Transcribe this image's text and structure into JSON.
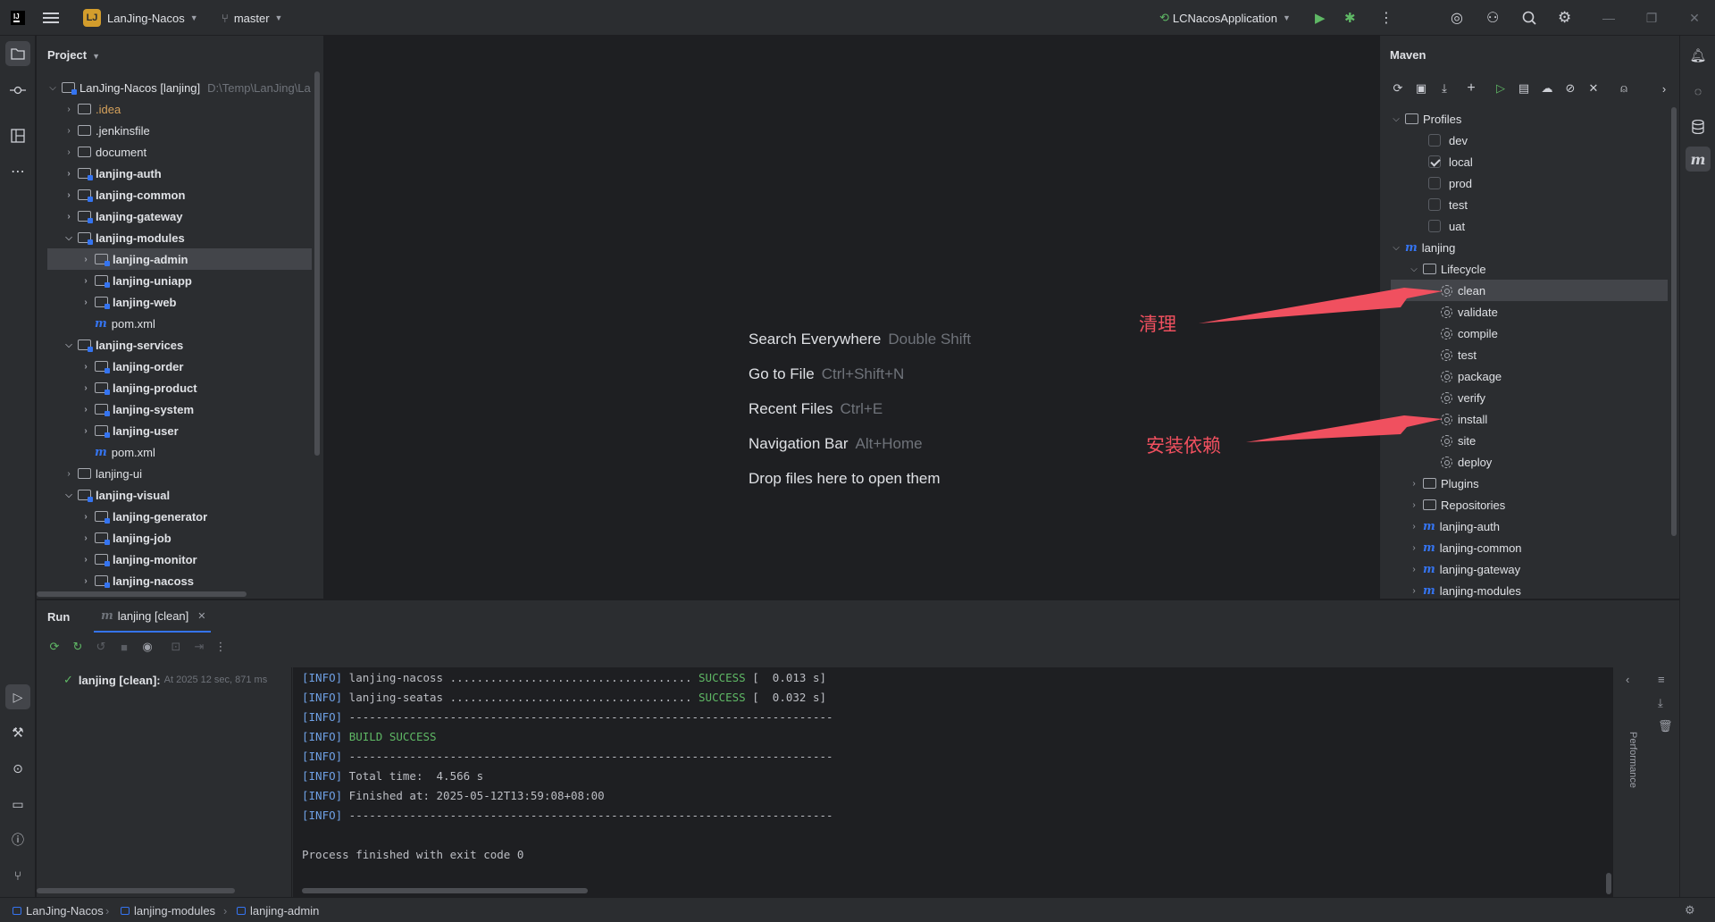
{
  "titlebar": {
    "project_badge": "LJ",
    "project_name": "LanJing-Nacos",
    "branch": "master",
    "run_config": "LCNacosApplication"
  },
  "project_panel": {
    "title": "Project",
    "root": {
      "label": "LanJing-Nacos [lanjing]",
      "path": "D:\\Temp\\LanJing\\La"
    },
    "items": [
      {
        "label": ".idea"
      },
      {
        "label": ".jenkinsfile"
      },
      {
        "label": "document"
      },
      {
        "label": "lanjing-auth"
      },
      {
        "label": "lanjing-common"
      },
      {
        "label": "lanjing-gateway"
      },
      {
        "label": "lanjing-modules"
      },
      {
        "label": "lanjing-admin"
      },
      {
        "label": "lanjing-uniapp"
      },
      {
        "label": "lanjing-web"
      },
      {
        "label": "pom.xml"
      },
      {
        "label": "lanjing-services"
      },
      {
        "label": "lanjing-order"
      },
      {
        "label": "lanjing-product"
      },
      {
        "label": "lanjing-system"
      },
      {
        "label": "lanjing-user"
      },
      {
        "label": "pom.xml"
      },
      {
        "label": "lanjing-ui"
      },
      {
        "label": "lanjing-visual"
      },
      {
        "label": "lanjing-generator"
      },
      {
        "label": "lanjing-job"
      },
      {
        "label": "lanjing-monitor"
      },
      {
        "label": "lanjing-nacoss"
      }
    ]
  },
  "editor": {
    "hints": [
      {
        "label": "Search Everywhere",
        "key": "Double Shift"
      },
      {
        "label": "Go to File",
        "key": "Ctrl+Shift+N"
      },
      {
        "label": "Recent Files",
        "key": "Ctrl+E"
      },
      {
        "label": "Navigation Bar",
        "key": "Alt+Home"
      },
      {
        "label": "Drop files here to open them",
        "key": ""
      }
    ]
  },
  "maven": {
    "title": "Maven",
    "profiles_label": "Profiles",
    "profiles": [
      {
        "label": "dev",
        "checked": false
      },
      {
        "label": "local",
        "checked": true
      },
      {
        "label": "prod",
        "checked": false
      },
      {
        "label": "test",
        "checked": false
      },
      {
        "label": "uat",
        "checked": false
      }
    ],
    "project_label": "lanjing",
    "lifecycle_label": "Lifecycle",
    "lifecycle": [
      "clean",
      "validate",
      "compile",
      "test",
      "package",
      "verify",
      "install",
      "site",
      "deploy"
    ],
    "others": [
      "Plugins",
      "Repositories",
      "lanjing-auth",
      "lanjing-common",
      "lanjing-gateway",
      "lanjing-modules"
    ]
  },
  "annotations": {
    "clean": "清理",
    "install": "安装依赖",
    "color": "#f0505f"
  },
  "run": {
    "tab_run": "Run",
    "tab_config": "lanjing [clean]",
    "tree_label": "lanjing [clean]:",
    "tree_meta": "At 2025 12 sec, 871 ms",
    "side_label": "Performance",
    "console": [
      {
        "tag": "[INFO]",
        "text": " lanjing-nacoss .................................... ",
        "status": "SUCCESS",
        "tail": " [  0.013 s]"
      },
      {
        "tag": "[INFO]",
        "text": " lanjing-seatas .................................... ",
        "status": "SUCCESS",
        "tail": " [  0.032 s]"
      },
      {
        "tag": "[INFO]",
        "text": " ------------------------------------------------------------------------",
        "status": "",
        "tail": ""
      },
      {
        "tag": "[INFO]",
        "text": " ",
        "status": "BUILD SUCCESS",
        "tail": ""
      },
      {
        "tag": "[INFO]",
        "text": " ------------------------------------------------------------------------",
        "status": "",
        "tail": ""
      },
      {
        "tag": "[INFO]",
        "text": " Total time:  4.566 s",
        "status": "",
        "tail": ""
      },
      {
        "tag": "[INFO]",
        "text": " Finished at: 2025-05-12T13:59:08+08:00",
        "status": "",
        "tail": ""
      },
      {
        "tag": "[INFO]",
        "text": " ------------------------------------------------------------------------",
        "status": "",
        "tail": ""
      }
    ],
    "exit_line": "Process finished with exit code 0"
  },
  "statusbar": {
    "crumbs": [
      "LanJing-Nacos",
      "lanjing-modules",
      "lanjing-admin"
    ]
  },
  "colors": {
    "accent": "#3574f0",
    "success": "#5fb865",
    "info_tag": "#6fa1e6",
    "annotation": "#f0505f"
  }
}
